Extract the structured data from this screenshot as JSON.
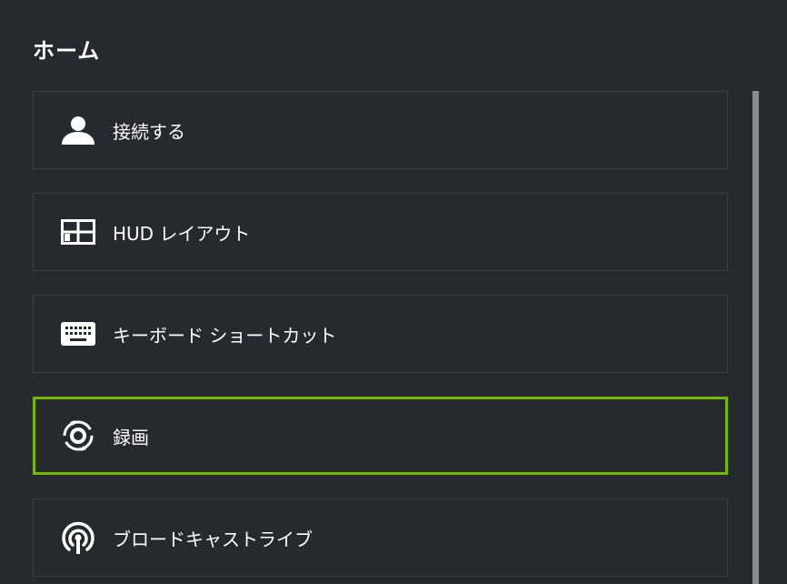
{
  "header": {
    "title": "ホーム"
  },
  "menu": {
    "items": [
      {
        "label": "接続する",
        "icon": "person-icon",
        "selected": false
      },
      {
        "label": "HUD レイアウト",
        "icon": "layout-grid-icon",
        "selected": false
      },
      {
        "label": "キーボード ショートカット",
        "icon": "keyboard-icon",
        "selected": false
      },
      {
        "label": "録画",
        "icon": "record-icon",
        "selected": true
      },
      {
        "label": "ブロードキャストライブ",
        "icon": "broadcast-icon",
        "selected": false
      }
    ]
  },
  "colors": {
    "background": "#262a2e",
    "border": "#3a3e43",
    "accent": "#76b900",
    "scrollbar": "#8a8d90"
  }
}
